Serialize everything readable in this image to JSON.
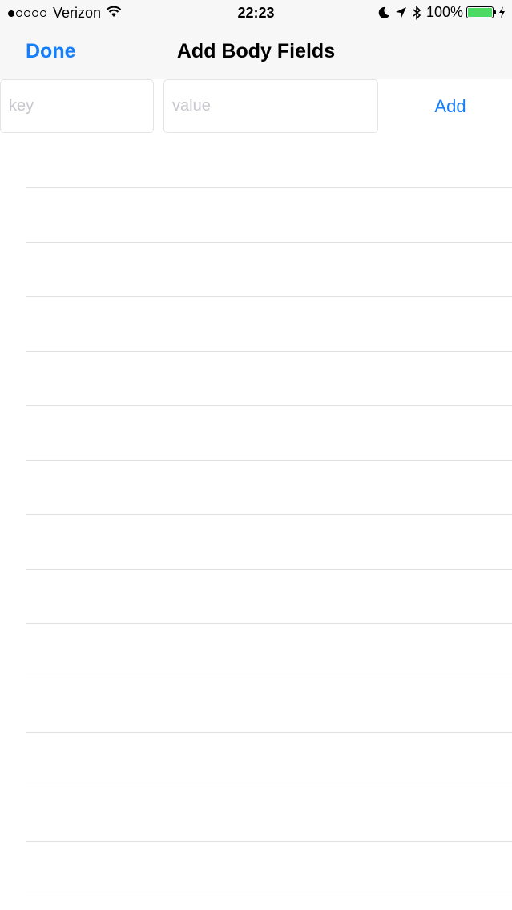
{
  "status_bar": {
    "carrier": "Verizon",
    "time": "22:23",
    "battery_percent": "100%",
    "signal_bars": 1,
    "signal_total": 5,
    "icons": [
      "wifi-icon",
      "moon-icon",
      "location-arrow-icon",
      "bluetooth-icon",
      "battery-icon",
      "charging-bolt-icon"
    ]
  },
  "nav": {
    "title": "Add Body Fields",
    "done_label": "Done"
  },
  "form": {
    "key_placeholder": "key",
    "value_placeholder": "value",
    "add_label": "Add"
  },
  "table": {
    "row_count": 14
  },
  "colors": {
    "accent": "#157efb",
    "battery": "#4cd964",
    "nav_background": "#f7f7f7",
    "separator": "#e0e0e0"
  }
}
